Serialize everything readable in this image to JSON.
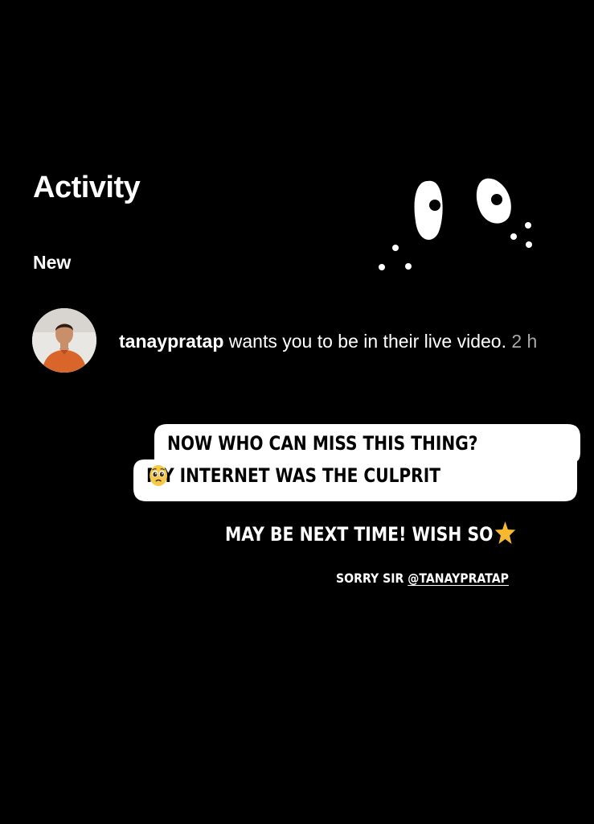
{
  "header": {
    "title": "Activity"
  },
  "section": {
    "label": "New"
  },
  "notification": {
    "username": "tanaypratap",
    "message": " wants you to be in their live video.",
    "time": " 2 h"
  },
  "caption": {
    "line1": "NOW WHO CAN MISS THIS THING?",
    "line2": "MY INTERNET WAS THE CULPRIT"
  },
  "next_time": "MAY BE NEXT TIME! WISH SO",
  "sorry": {
    "prefix": "SORRY SIR ",
    "mention": "@TANAYPRATAP"
  },
  "icons": {
    "eyes": "cartoon-eyes-icon",
    "face": "pleading-face-icon",
    "star": "star-icon"
  },
  "colors": {
    "background": "#000000",
    "text": "#ffffff",
    "caption_box": "#ffffff",
    "time": "#a8a8a8",
    "star": "#f5b82e",
    "emoji": "#f7c948"
  }
}
